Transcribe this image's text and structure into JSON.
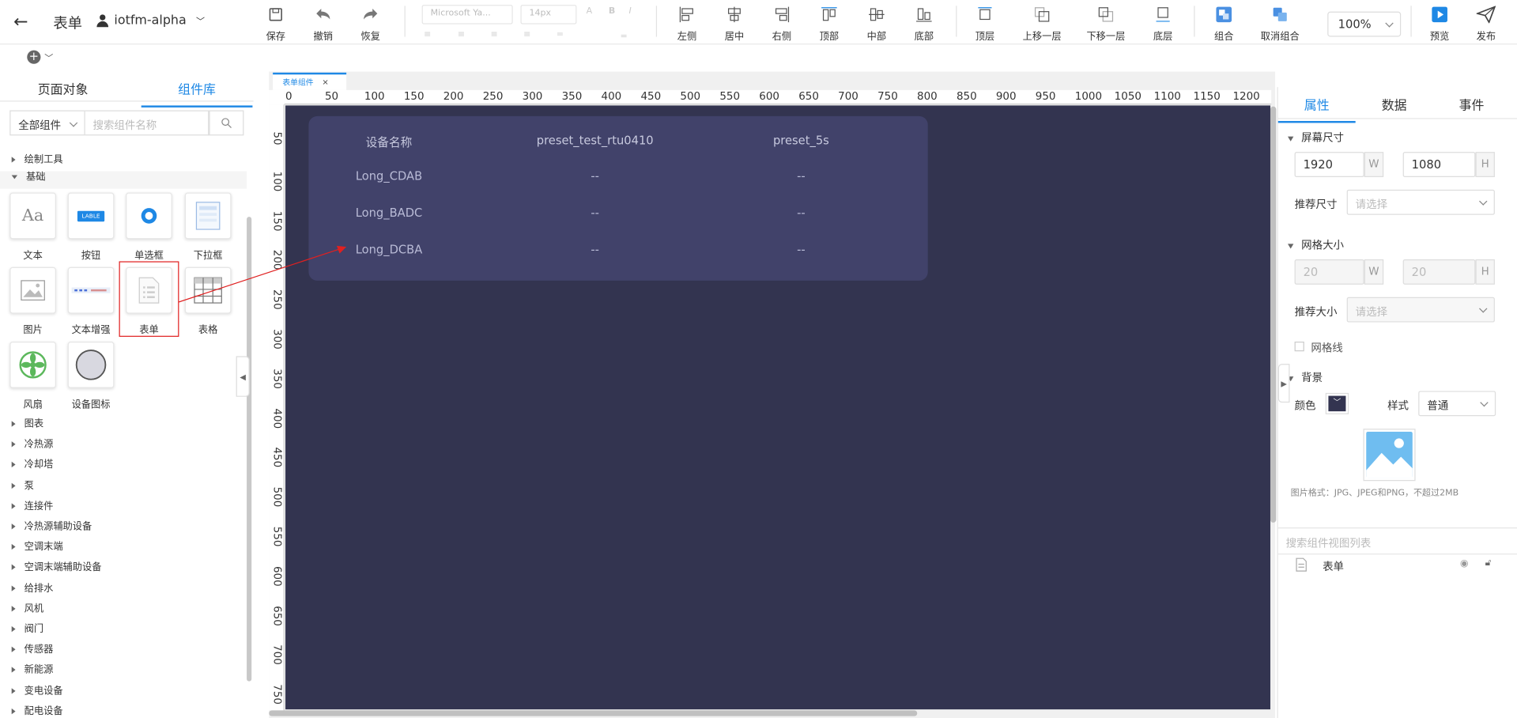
{
  "header": {
    "back": "←",
    "title": "表单",
    "project": "iotfm-alpha"
  },
  "toolbar": {
    "save": "保存",
    "undo": "撤销",
    "redo": "恢复",
    "font": "Microsoft Ya...",
    "font_size": "14px",
    "align_left": "左侧",
    "align_center": "居中",
    "align_right": "右侧",
    "align_top": "顶部",
    "align_middle": "中部",
    "align_bottom": "底部",
    "layer_top": "顶层",
    "layer_up": "上移一层",
    "layer_down": "下移一层",
    "layer_bottom": "底层",
    "group": "组合",
    "ungroup": "取消组合",
    "zoom": "100%",
    "preview": "预览",
    "publish": "发布"
  },
  "left": {
    "tab_objects": "页面对象",
    "tab_library": "组件库",
    "category": "全部组件",
    "search_placeholder": "搜索组件名称",
    "tree_top": [
      {
        "label": "绘制工具"
      },
      {
        "label": "基础"
      }
    ],
    "components": [
      {
        "label": "文本",
        "icon": "text-icon"
      },
      {
        "label": "按钮",
        "icon": "button-icon",
        "glyph": "LABLE"
      },
      {
        "label": "单选框",
        "icon": "radio-icon"
      },
      {
        "label": "下拉框",
        "icon": "dropdown-icon"
      },
      {
        "label": "图片",
        "icon": "image-icon"
      },
      {
        "label": "文本增强",
        "icon": "rich-text-icon"
      },
      {
        "label": "表单",
        "icon": "form-icon"
      },
      {
        "label": "表格",
        "icon": "table-icon"
      },
      {
        "label": "风扇",
        "icon": "fan-icon"
      },
      {
        "label": "设备图标",
        "icon": "device-icon"
      }
    ],
    "tree_bottom": [
      {
        "label": "图表"
      },
      {
        "label": "冷热源"
      },
      {
        "label": "冷却塔"
      },
      {
        "label": "泵"
      },
      {
        "label": "连接件"
      },
      {
        "label": "冷热源辅助设备"
      },
      {
        "label": "空调末端"
      },
      {
        "label": "空调末端辅助设备"
      },
      {
        "label": "给排水"
      },
      {
        "label": "风机"
      },
      {
        "label": "阀门"
      },
      {
        "label": "传感器"
      },
      {
        "label": "新能源"
      },
      {
        "label": "变电设备"
      },
      {
        "label": "配电设备"
      }
    ]
  },
  "canvas": {
    "doc_tab": "表单组件",
    "hticks": [
      "0",
      "50",
      "100",
      "150",
      "200",
      "250",
      "300",
      "350",
      "400",
      "450",
      "500",
      "550",
      "600",
      "650",
      "700",
      "750",
      "800",
      "850",
      "900",
      "950",
      "1000",
      "1050",
      "1100",
      "1150",
      "1200"
    ],
    "vticks": [
      "50",
      "100",
      "150",
      "200",
      "250",
      "300",
      "350",
      "400",
      "450",
      "500",
      "550",
      "600",
      "650",
      "700",
      "750"
    ],
    "table": {
      "headers": [
        "设备名称",
        "preset_test_rtu0410",
        "preset_5s"
      ],
      "rows": [
        [
          "Long_CDAB",
          "--",
          "--"
        ],
        [
          "Long_BADC",
          "--",
          "--"
        ],
        [
          "Long_DCBA",
          "--",
          "--"
        ]
      ]
    },
    "stage_color": "#333450"
  },
  "right": {
    "tabs": [
      "属性",
      "数据",
      "事件"
    ],
    "screen_size": "屏幕尺寸",
    "width": "1920",
    "w": "W",
    "height": "1080",
    "h": "H",
    "recommend_size": "推荐尺寸",
    "select_placeholder": "请选择",
    "grid_size": "网格大小",
    "grid_w": "20",
    "grid_h": "20",
    "recommend_size2": "推荐大小",
    "grid_lines": "网格线",
    "background": "背景",
    "color": "颜色",
    "style": "样式",
    "style_value": "普通",
    "image_hint": "图片格式：JPG、JPEG和PNG，不超过2MB",
    "layer_search": "搜索组件视图列表",
    "layer_item": "表单"
  }
}
